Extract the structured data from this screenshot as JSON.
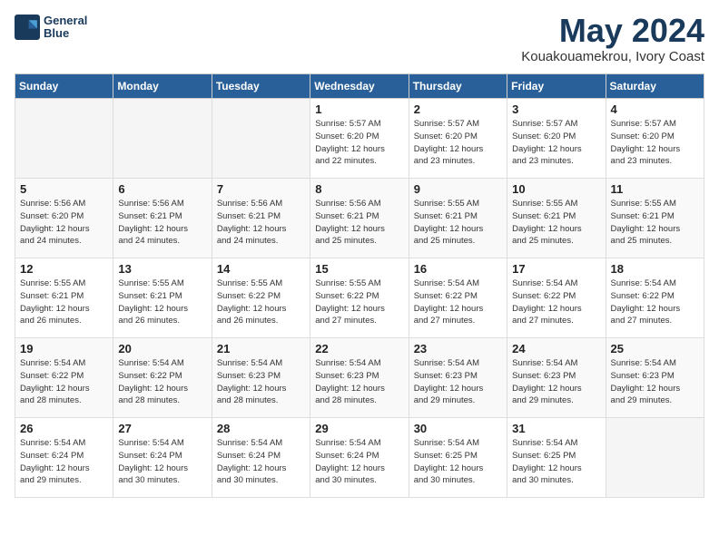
{
  "logo": {
    "line1": "General",
    "line2": "Blue"
  },
  "title": "May 2024",
  "subtitle": "Kouakouamekrou, Ivory Coast",
  "weekdays": [
    "Sunday",
    "Monday",
    "Tuesday",
    "Wednesday",
    "Thursday",
    "Friday",
    "Saturday"
  ],
  "weeks": [
    [
      {
        "day": "",
        "info": ""
      },
      {
        "day": "",
        "info": ""
      },
      {
        "day": "",
        "info": ""
      },
      {
        "day": "1",
        "info": "Sunrise: 5:57 AM\nSunset: 6:20 PM\nDaylight: 12 hours\nand 22 minutes."
      },
      {
        "day": "2",
        "info": "Sunrise: 5:57 AM\nSunset: 6:20 PM\nDaylight: 12 hours\nand 23 minutes."
      },
      {
        "day": "3",
        "info": "Sunrise: 5:57 AM\nSunset: 6:20 PM\nDaylight: 12 hours\nand 23 minutes."
      },
      {
        "day": "4",
        "info": "Sunrise: 5:57 AM\nSunset: 6:20 PM\nDaylight: 12 hours\nand 23 minutes."
      }
    ],
    [
      {
        "day": "5",
        "info": "Sunrise: 5:56 AM\nSunset: 6:20 PM\nDaylight: 12 hours\nand 24 minutes."
      },
      {
        "day": "6",
        "info": "Sunrise: 5:56 AM\nSunset: 6:21 PM\nDaylight: 12 hours\nand 24 minutes."
      },
      {
        "day": "7",
        "info": "Sunrise: 5:56 AM\nSunset: 6:21 PM\nDaylight: 12 hours\nand 24 minutes."
      },
      {
        "day": "8",
        "info": "Sunrise: 5:56 AM\nSunset: 6:21 PM\nDaylight: 12 hours\nand 25 minutes."
      },
      {
        "day": "9",
        "info": "Sunrise: 5:55 AM\nSunset: 6:21 PM\nDaylight: 12 hours\nand 25 minutes."
      },
      {
        "day": "10",
        "info": "Sunrise: 5:55 AM\nSunset: 6:21 PM\nDaylight: 12 hours\nand 25 minutes."
      },
      {
        "day": "11",
        "info": "Sunrise: 5:55 AM\nSunset: 6:21 PM\nDaylight: 12 hours\nand 25 minutes."
      }
    ],
    [
      {
        "day": "12",
        "info": "Sunrise: 5:55 AM\nSunset: 6:21 PM\nDaylight: 12 hours\nand 26 minutes."
      },
      {
        "day": "13",
        "info": "Sunrise: 5:55 AM\nSunset: 6:21 PM\nDaylight: 12 hours\nand 26 minutes."
      },
      {
        "day": "14",
        "info": "Sunrise: 5:55 AM\nSunset: 6:22 PM\nDaylight: 12 hours\nand 26 minutes."
      },
      {
        "day": "15",
        "info": "Sunrise: 5:55 AM\nSunset: 6:22 PM\nDaylight: 12 hours\nand 27 minutes."
      },
      {
        "day": "16",
        "info": "Sunrise: 5:54 AM\nSunset: 6:22 PM\nDaylight: 12 hours\nand 27 minutes."
      },
      {
        "day": "17",
        "info": "Sunrise: 5:54 AM\nSunset: 6:22 PM\nDaylight: 12 hours\nand 27 minutes."
      },
      {
        "day": "18",
        "info": "Sunrise: 5:54 AM\nSunset: 6:22 PM\nDaylight: 12 hours\nand 27 minutes."
      }
    ],
    [
      {
        "day": "19",
        "info": "Sunrise: 5:54 AM\nSunset: 6:22 PM\nDaylight: 12 hours\nand 28 minutes."
      },
      {
        "day": "20",
        "info": "Sunrise: 5:54 AM\nSunset: 6:22 PM\nDaylight: 12 hours\nand 28 minutes."
      },
      {
        "day": "21",
        "info": "Sunrise: 5:54 AM\nSunset: 6:23 PM\nDaylight: 12 hours\nand 28 minutes."
      },
      {
        "day": "22",
        "info": "Sunrise: 5:54 AM\nSunset: 6:23 PM\nDaylight: 12 hours\nand 28 minutes."
      },
      {
        "day": "23",
        "info": "Sunrise: 5:54 AM\nSunset: 6:23 PM\nDaylight: 12 hours\nand 29 minutes."
      },
      {
        "day": "24",
        "info": "Sunrise: 5:54 AM\nSunset: 6:23 PM\nDaylight: 12 hours\nand 29 minutes."
      },
      {
        "day": "25",
        "info": "Sunrise: 5:54 AM\nSunset: 6:23 PM\nDaylight: 12 hours\nand 29 minutes."
      }
    ],
    [
      {
        "day": "26",
        "info": "Sunrise: 5:54 AM\nSunset: 6:24 PM\nDaylight: 12 hours\nand 29 minutes."
      },
      {
        "day": "27",
        "info": "Sunrise: 5:54 AM\nSunset: 6:24 PM\nDaylight: 12 hours\nand 30 minutes."
      },
      {
        "day": "28",
        "info": "Sunrise: 5:54 AM\nSunset: 6:24 PM\nDaylight: 12 hours\nand 30 minutes."
      },
      {
        "day": "29",
        "info": "Sunrise: 5:54 AM\nSunset: 6:24 PM\nDaylight: 12 hours\nand 30 minutes."
      },
      {
        "day": "30",
        "info": "Sunrise: 5:54 AM\nSunset: 6:25 PM\nDaylight: 12 hours\nand 30 minutes."
      },
      {
        "day": "31",
        "info": "Sunrise: 5:54 AM\nSunset: 6:25 PM\nDaylight: 12 hours\nand 30 minutes."
      },
      {
        "day": "",
        "info": ""
      }
    ]
  ]
}
